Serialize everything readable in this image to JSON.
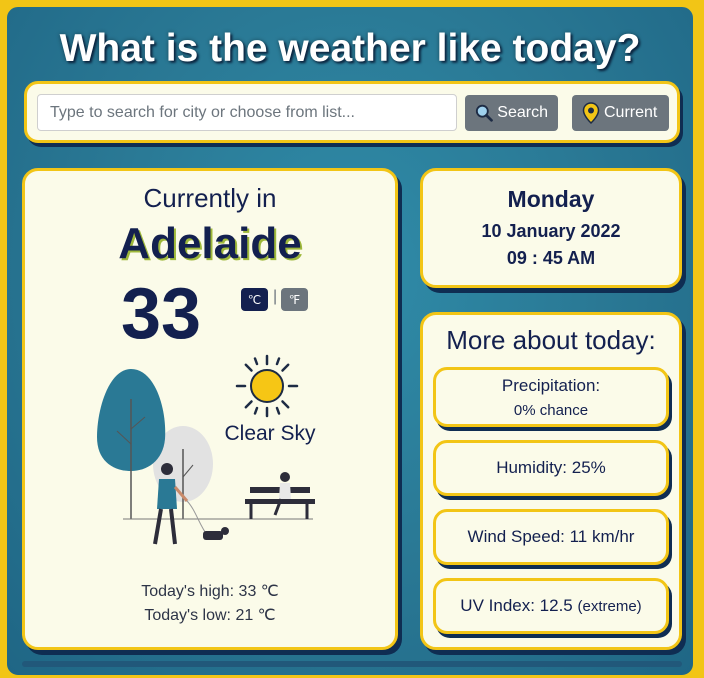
{
  "header": {
    "title": "What is the weather like today?"
  },
  "search": {
    "placeholder": "Type to search for city or choose from list...",
    "value": "",
    "search_label": "Search",
    "current_label": "Current"
  },
  "current": {
    "label": "Currently in",
    "city": "Adelaide",
    "temperature": "33",
    "unit_c": "℃",
    "unit_f": "℉",
    "unit_separator": "|",
    "condition": "Clear Sky",
    "high": "Today's high: 33 ℃",
    "low": "Today's low: 21 ℃"
  },
  "date": {
    "day": "Monday",
    "date": "10 January 2022",
    "time": "09 : 45 AM"
  },
  "more": {
    "title": "More about today:",
    "precip_label": "Precipitation:",
    "precip_value": "0% chance",
    "humidity": "Humidity: 25%",
    "wind": "Wind Speed: 11 km/hr",
    "uv": "UV Index: 12.5",
    "uv_level": "(extreme)"
  },
  "colors": {
    "accent": "#f2c516",
    "navy": "#13204f",
    "background": "#2a7995",
    "card": "#fbfbe9"
  },
  "icons": {
    "search": "magnifier-icon",
    "current": "location-pin-icon",
    "weather": "sun-icon"
  }
}
